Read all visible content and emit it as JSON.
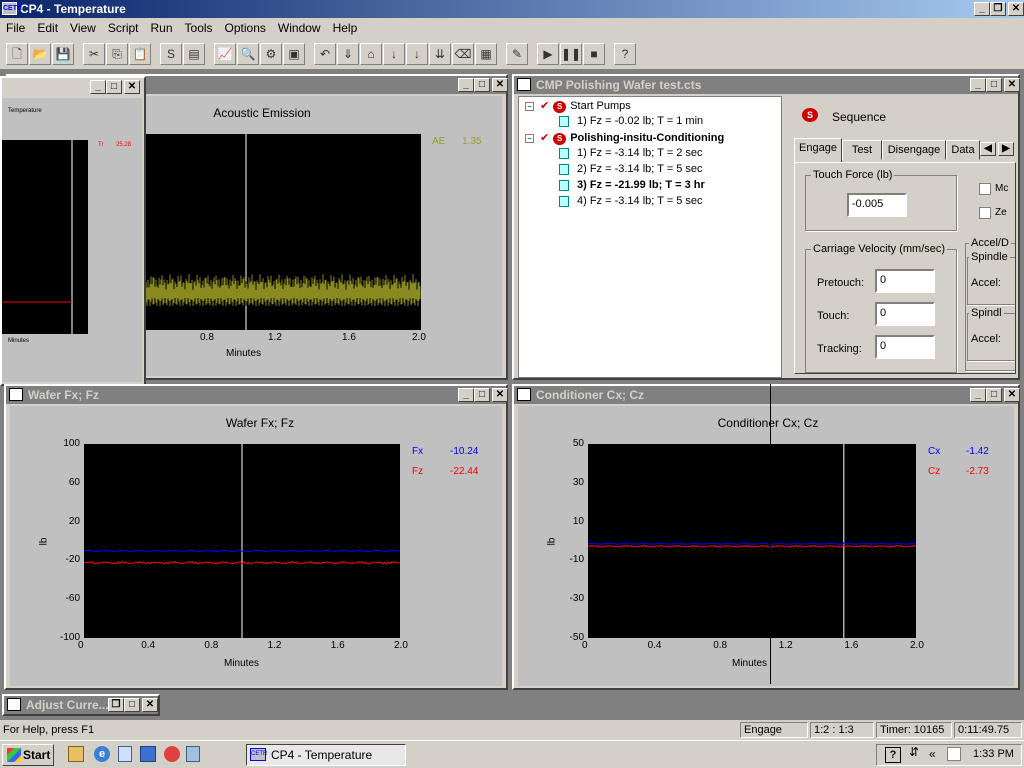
{
  "app": {
    "title": "CP4 - Temperature",
    "icon_text": "CETR"
  },
  "menu": [
    "File",
    "Edit",
    "View",
    "Script",
    "Run",
    "Tools",
    "Options",
    "Window",
    "Help"
  ],
  "toolbar_icons": [
    "new-icon",
    "open-icon",
    "save-icon",
    "cut-icon",
    "copy-icon",
    "paste-icon",
    "sequence-icon",
    "document-icon",
    "chart-icon",
    "zoom-icon",
    "settings-icon",
    "image-icon",
    "undo-icon",
    "down-icon",
    "weight-icon",
    "down-count-icon",
    "down-arrow-icon",
    "down-many-icon",
    "eraser-icon",
    "grid-icon",
    "edit-icon",
    "play-icon",
    "pause-icon",
    "stop-icon",
    "help-icon"
  ],
  "temp_window": {
    "title": "",
    "inner_label": "Temperature",
    "value_label": "Tr",
    "value": "25.28",
    "xlabel": "Minutes"
  },
  "acoustic": {
    "title": "Acoustic Emission",
    "legend": [
      {
        "name": "AE",
        "value": "1.35"
      }
    ],
    "xticks": [
      "0.8",
      "1.2",
      "1.6",
      "2.0"
    ],
    "xlabel": "Minutes"
  },
  "sequence_window": {
    "title": "CMP Polishing Wafer test.cts",
    "tree": [
      {
        "label": "Start Pumps",
        "level": 0,
        "bold": false
      },
      {
        "label": "1)  Fz = -0.02 lb; T = 1 min",
        "level": 1,
        "bold": false
      },
      {
        "label": "Polishing-insitu-Conditioning",
        "level": 0,
        "bold": true
      },
      {
        "label": "1)  Fz = -3.14 lb; T = 2 sec",
        "level": 1,
        "bold": false
      },
      {
        "label": "2)  Fz = -3.14 lb; T = 5 sec",
        "level": 1,
        "bold": false
      },
      {
        "label": "3)  Fz = -21.99 lb; T = 3 hr",
        "level": 1,
        "bold": true
      },
      {
        "label": "4)  Fz = -3.14 lb; T = 5 sec",
        "level": 1,
        "bold": false
      }
    ],
    "sequence_label": "Sequence",
    "tabs": [
      "Engage",
      "Test",
      "Disengage",
      "Data"
    ],
    "touch_force_label": "Touch Force (lb)",
    "touch_force_value": "-0.005",
    "carriage_label": "Carriage Velocity (mm/sec)",
    "pretouch_label": "Pretouch:",
    "pretouch_value": "0",
    "touch_label": "Touch:",
    "touch_value": "0",
    "tracking_label": "Tracking:",
    "tracking_value": "0",
    "chk1_label": "Mc",
    "chk2_label": "Ze",
    "accel_group": "Accel/D",
    "spindle1": "Spindle",
    "accel1": "Accel:",
    "spindle2": "Spindl",
    "accel2": "Accel:"
  },
  "wafer": {
    "title": "Wafer Fx; Fz",
    "plot_title": "Wafer Fx; Fz",
    "ylabel": "lb",
    "xlabel": "Minutes",
    "yticks": [
      "100",
      "60",
      "20",
      "-20",
      "-60",
      "-100"
    ],
    "xticks": [
      "0",
      "0.4",
      "0.8",
      "1.2",
      "1.6",
      "2.0"
    ],
    "legend": [
      {
        "name": "Fx",
        "value": "-10.24",
        "color": "#0000ff"
      },
      {
        "name": "Fz",
        "value": "-22.44",
        "color": "#ff0000"
      }
    ]
  },
  "conditioner": {
    "title": "Conditioner Cx; Cz",
    "plot_title": "Conditioner Cx; Cz",
    "ylabel": "lb",
    "xlabel": "Minutes",
    "yticks": [
      "50",
      "30",
      "10",
      "-10",
      "-30",
      "-50"
    ],
    "xticks": [
      "0",
      "0.4",
      "0.8",
      "1.2",
      "1.6",
      "2.0"
    ],
    "legend": [
      {
        "name": "Cx",
        "value": "-1.42",
        "color": "#0000ff"
      },
      {
        "name": "Cz",
        "value": "-2.73",
        "color": "#ff0000"
      }
    ]
  },
  "minimized": {
    "title": "Adjust Curre..."
  },
  "status": {
    "help": "For Help, press F1",
    "mode": "Engage",
    "ratio": "1:2 : 1:3",
    "timer": "Timer: 10165",
    "elapsed": "0:11:49.75"
  },
  "taskbar": {
    "start": "Start",
    "task": "CP4 - Temperature",
    "clock": "1:33 PM"
  },
  "chart_data": [
    {
      "type": "line",
      "title": "Acoustic Emission",
      "xlabel": "Minutes",
      "ylabel": "",
      "series": [
        {
          "name": "AE",
          "color": "#9b9b2a",
          "last": 1.35
        }
      ],
      "xlim": [
        0,
        2.0
      ],
      "x_ticks_shown": [
        "0.8",
        "1.2",
        "1.6",
        "2.0"
      ]
    },
    {
      "type": "line",
      "title": "Wafer Fx; Fz",
      "xlabel": "Minutes",
      "ylabel": "lb",
      "ylim": [
        -100,
        100
      ],
      "xlim": [
        0,
        2.0
      ],
      "series": [
        {
          "name": "Fx",
          "color": "#0000ff",
          "last": -10.24
        },
        {
          "name": "Fz",
          "color": "#ff0000",
          "last": -22.44
        }
      ]
    },
    {
      "type": "line",
      "title": "Conditioner Cx; Cz",
      "xlabel": "Minutes",
      "ylabel": "lb",
      "ylim": [
        -50,
        50
      ],
      "xlim": [
        0,
        2.0
      ],
      "series": [
        {
          "name": "Cx",
          "color": "#0000ff",
          "last": -1.42
        },
        {
          "name": "Cz",
          "color": "#ff0000",
          "last": -2.73
        }
      ]
    }
  ]
}
